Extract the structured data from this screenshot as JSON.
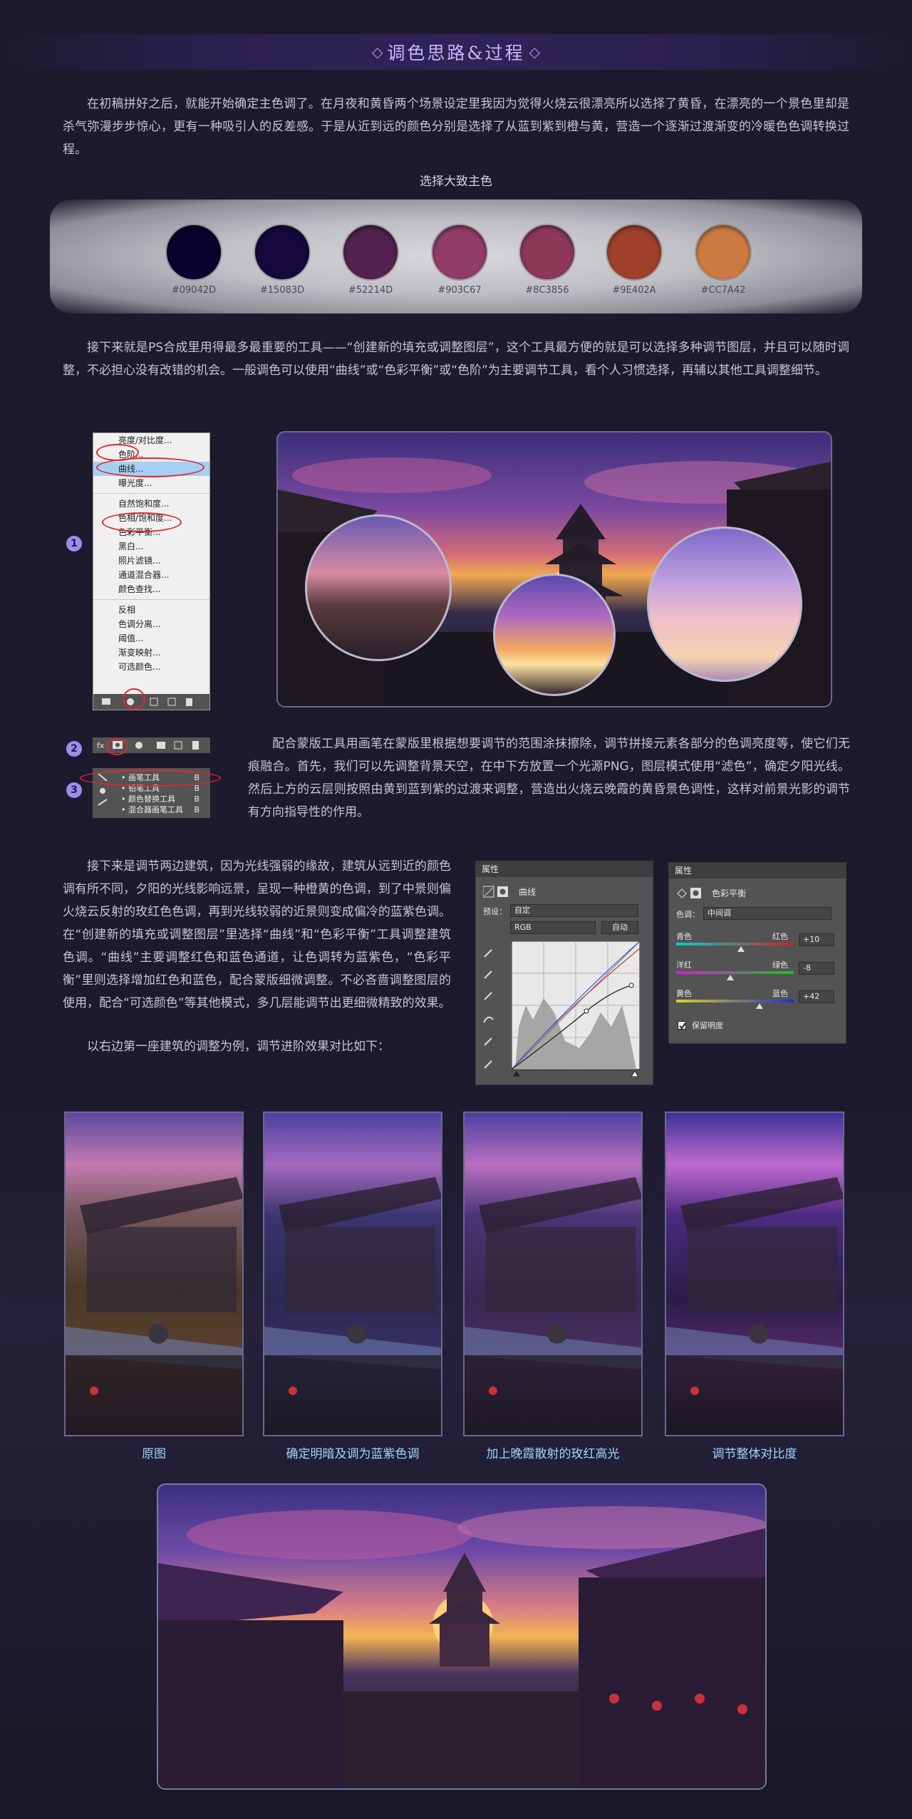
{
  "header": {
    "title": "调色思路&过程",
    "deco_left": "◇",
    "deco_right": "◇"
  },
  "intro": {
    "paragraph": "在初稿拼好之后，就能开始确定主色调了。在月夜和黄昏两个场景设定里我因为觉得火烧云很漂亮所以选择了黄昏，在漂亮的一个景色里却是杀气弥漫步步惊心，更有一种吸引人的反差感。于是从近到远的颜色分别是选择了从蓝到紫到橙与黄，营造一个逐渐过渡渐变的冷暖色色调转换过程。",
    "palette_heading": "选择大致主色"
  },
  "palette": [
    {
      "hex": "#09042D",
      "label": "#09042D"
    },
    {
      "hex": "#15083D",
      "label": "#15083D"
    },
    {
      "hex": "#52214D",
      "label": "#52214D"
    },
    {
      "hex": "#903C67",
      "label": "#903C67"
    },
    {
      "hex": "#8C3856",
      "label": "#8C3856"
    },
    {
      "hex": "#9E402A",
      "label": "#9E402A"
    },
    {
      "hex": "#CC7A42",
      "label": "#CC7A42"
    }
  ],
  "section2": {
    "paragraph": "接下来就是PS合成里用得最多最重要的工具——“创建新的填充或调整图层”，这个工具最方便的就是可以选择多种调节图层，并且可以随时调整，不必担心没有改错的机会。一般调色可以使用“曲线”或“色彩平衡”或“色阶”为主要调节工具，看个人习惯选择，再辅以其他工具调整细节。"
  },
  "ps_menu": {
    "items_group1": [
      "亮度/对比度...",
      "色阶...",
      "曲线...",
      "曝光度..."
    ],
    "items_group2": [
      "自然饱和度...",
      "色相/饱和度...",
      "色彩平衡...",
      "黑白...",
      "照片滤镜...",
      "通道混合器...",
      "颜色查找..."
    ],
    "items_group3": [
      "反相",
      "色调分离...",
      "阈值...",
      "渐变映射...",
      "可选颜色..."
    ]
  },
  "markers": {
    "m1": "1",
    "m2": "2",
    "m3": "3"
  },
  "layers_tools": [
    {
      "label": "画笔工具",
      "key": "B"
    },
    {
      "label": "铅笔工具",
      "key": "B"
    },
    {
      "label": "颜色替换工具",
      "key": "B"
    },
    {
      "label": "混合器画笔工具",
      "key": "B"
    }
  ],
  "section3": {
    "paragraph": "配合蒙版工具用画笔在蒙版里根据想要调节的范围涂抹擦除，调节拼接元素各部分的色调亮度等，使它们无痕融合。首先，我们可以先调整背景天空，在中下方放置一个光源PNG，图层模式使用“滤色”，确定夕阳光线。然后上方的云层则按照由黄到蓝到紫的过渡来调整，营造出火烧云晚霞的黄昏景色调性，这样对前景光影的调节有方向指导性的作用。"
  },
  "section4": {
    "paragraph": "接下来是调节两边建筑，因为光线强弱的缘故，建筑从远到近的颜色调有所不同，夕阳的光线影响远景，呈现一种橙黄的色调，到了中景则偏火烧云反射的玫红色色调，再到光线较弱的近景则变成偏冷的蓝紫色调。在“创建新的填充或调整图层”里选择“曲线”和“色彩平衡”工具调整建筑色调。“曲线”主要调整红色和蓝色通道，让色调转为蓝紫色，“色彩平衡”里则选择增加红色和蓝色，配合蒙版细微调整。不必吝啬调整图层的使用，配合“可选颜色”等其他模式，多几层能调节出更细微精致的效果。",
    "paragraph2": "以右边第一座建筑的调整为例，调节进阶效果对比如下："
  },
  "curves_panel": {
    "header": "属性",
    "title": "曲线",
    "preset_label": "预设：",
    "preset_value": "自定",
    "channel": "RGB",
    "auto_button": "自动"
  },
  "balance_panel": {
    "header": "属性",
    "title": "色彩平衡",
    "tone_label": "色调：",
    "tone_value": "中间调",
    "rows": [
      {
        "left": "青色",
        "right": "红色",
        "value": "+10",
        "knob": 0.55
      },
      {
        "left": "洋红",
        "right": "绿色",
        "value": "-8",
        "knob": 0.46
      },
      {
        "left": "黄色",
        "right": "蓝色",
        "value": "+42",
        "knob": 0.71
      }
    ],
    "preserve_label": "保留明度"
  },
  "comparison": {
    "captions": [
      "原图",
      "确定明暗及调为蓝紫色调",
      "加上晚霞散射的玫红高光",
      "调节整体对比度"
    ]
  }
}
